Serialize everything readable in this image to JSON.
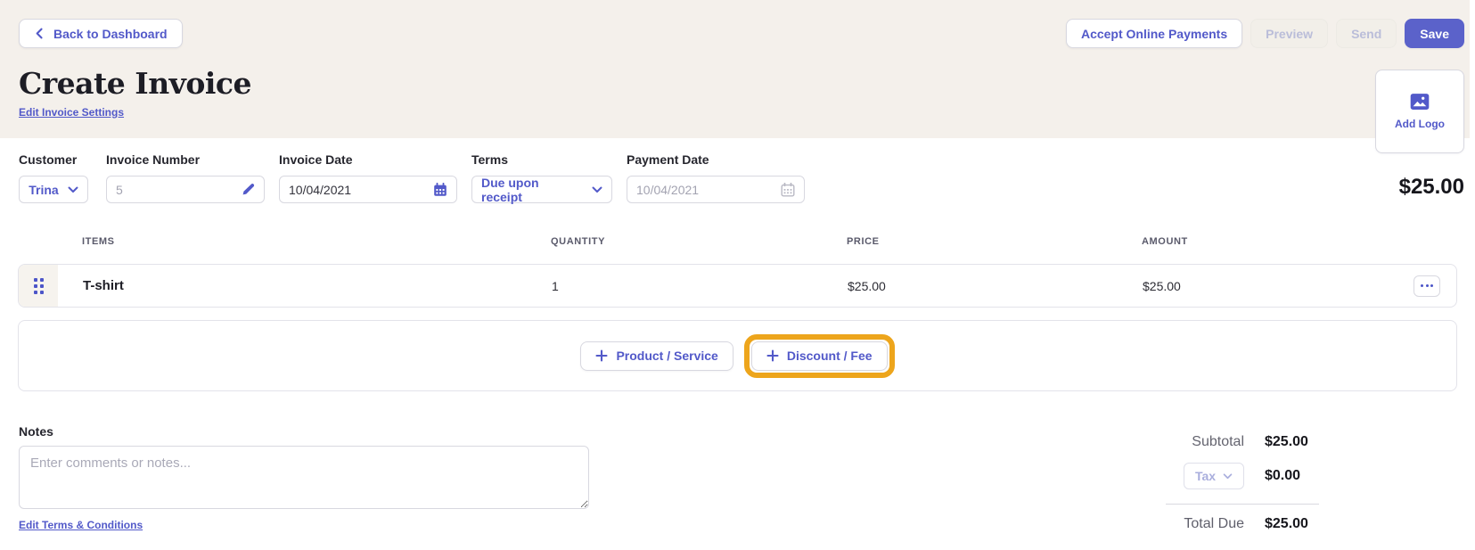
{
  "app": {
    "accent_color": "#5259c9",
    "highlight_color": "#eda51c",
    "header_bg": "#f4f0eb"
  },
  "header": {
    "back_label": "Back to Dashboard",
    "actions": {
      "accept": "Accept Online Payments",
      "preview": "Preview",
      "send": "Send",
      "save": "Save"
    },
    "title": "Create Invoice",
    "settings_link": "Edit Invoice Settings"
  },
  "logo_card": {
    "label": "Add Logo"
  },
  "invoice_total": "$25.00",
  "fields": {
    "customer": {
      "label": "Customer",
      "value": "Trina"
    },
    "invoice_number": {
      "label": "Invoice Number",
      "value": "5"
    },
    "invoice_date": {
      "label": "Invoice Date",
      "value": "10/04/2021"
    },
    "terms": {
      "label": "Terms",
      "value": "Due upon receipt"
    },
    "payment_date": {
      "label": "Payment Date",
      "value": "10/04/2021"
    }
  },
  "items_table": {
    "headers": {
      "items": "ITEMS",
      "quantity": "QUANTITY",
      "price": "PRICE",
      "amount": "AMOUNT"
    },
    "rows": [
      {
        "item": "T-shirt",
        "quantity": "1",
        "price": "$25.00",
        "amount": "$25.00"
      }
    ]
  },
  "add_actions": {
    "product_service": "Product / Service",
    "discount_fee": "Discount / Fee"
  },
  "notes": {
    "label": "Notes",
    "placeholder": "Enter comments or notes..."
  },
  "terms_conditions_link": "Edit Terms & Conditions",
  "totals": {
    "subtotal_label": "Subtotal",
    "subtotal_value": "$25.00",
    "tax_label": "Tax",
    "tax_value": "$0.00",
    "total_label": "Total Due",
    "total_value": "$25.00"
  },
  "icons": {
    "back": "chevron-left-icon",
    "dropdown": "chevron-down-icon",
    "edit": "pencil-icon",
    "date": "calendar-icon",
    "logo": "image-icon",
    "add": "plus-icon",
    "row_drag": "drag-handle-icon",
    "row_menu": "ellipsis-icon"
  }
}
